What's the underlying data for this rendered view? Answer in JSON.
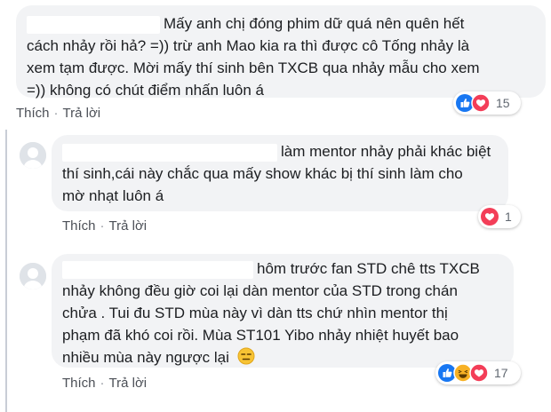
{
  "comments": [
    {
      "text_lines": [
        "Mấy anh chị đóng phim dữ quá nên quên hết",
        "cách nhảy rồi hả? =)) trừ anh Mao kia ra thì được cô Tống nhảy là",
        "xem tạm được. Mời mấy thí sinh bên TXCB qua nhảy mẫu cho xem",
        "=)) không có chút điểm nhấn luôn á"
      ],
      "actions": {
        "like": "Thích",
        "reply": "Trả lời"
      },
      "reactions": {
        "icons": [
          "like-icon",
          "love-icon"
        ],
        "count": "15"
      }
    },
    {
      "text_lines": [
        "làm mentor nhảy phải khác biệt",
        "thí sinh,cái này chắc qua mấy show khác bị thí sinh làm cho",
        "mờ nhạt luôn á"
      ],
      "actions": {
        "like": "Thích",
        "reply": "Trả lời"
      },
      "reactions": {
        "icons": [
          "love-icon"
        ],
        "count": "1"
      }
    },
    {
      "text_lines": [
        "hôm trước fan STD chê tts TXCB",
        "nhảy không đều giờ coi lại dàn mentor của STD trong chán",
        "chửa . Tui đu STD mùa này vì dàn tts chứ nhìn mentor thị",
        "phạm đã khó coi rồi. Mùa ST101 Yibo nhảy nhiệt huyết bao",
        "nhiều mùa này ngược lại"
      ],
      "emoji": "😑",
      "actions": {
        "like": "Thích",
        "reply": "Trả lời"
      },
      "reactions": {
        "icons": [
          "like-icon",
          "haha-icon",
          "love-icon"
        ],
        "count": "17"
      }
    }
  ],
  "colors": {
    "bubble": "#f2f3f5",
    "text": "#1c1e21",
    "action": "#4b4f56",
    "like": "#1877f2",
    "love": "#f33e58",
    "haha": "#f7b125"
  }
}
